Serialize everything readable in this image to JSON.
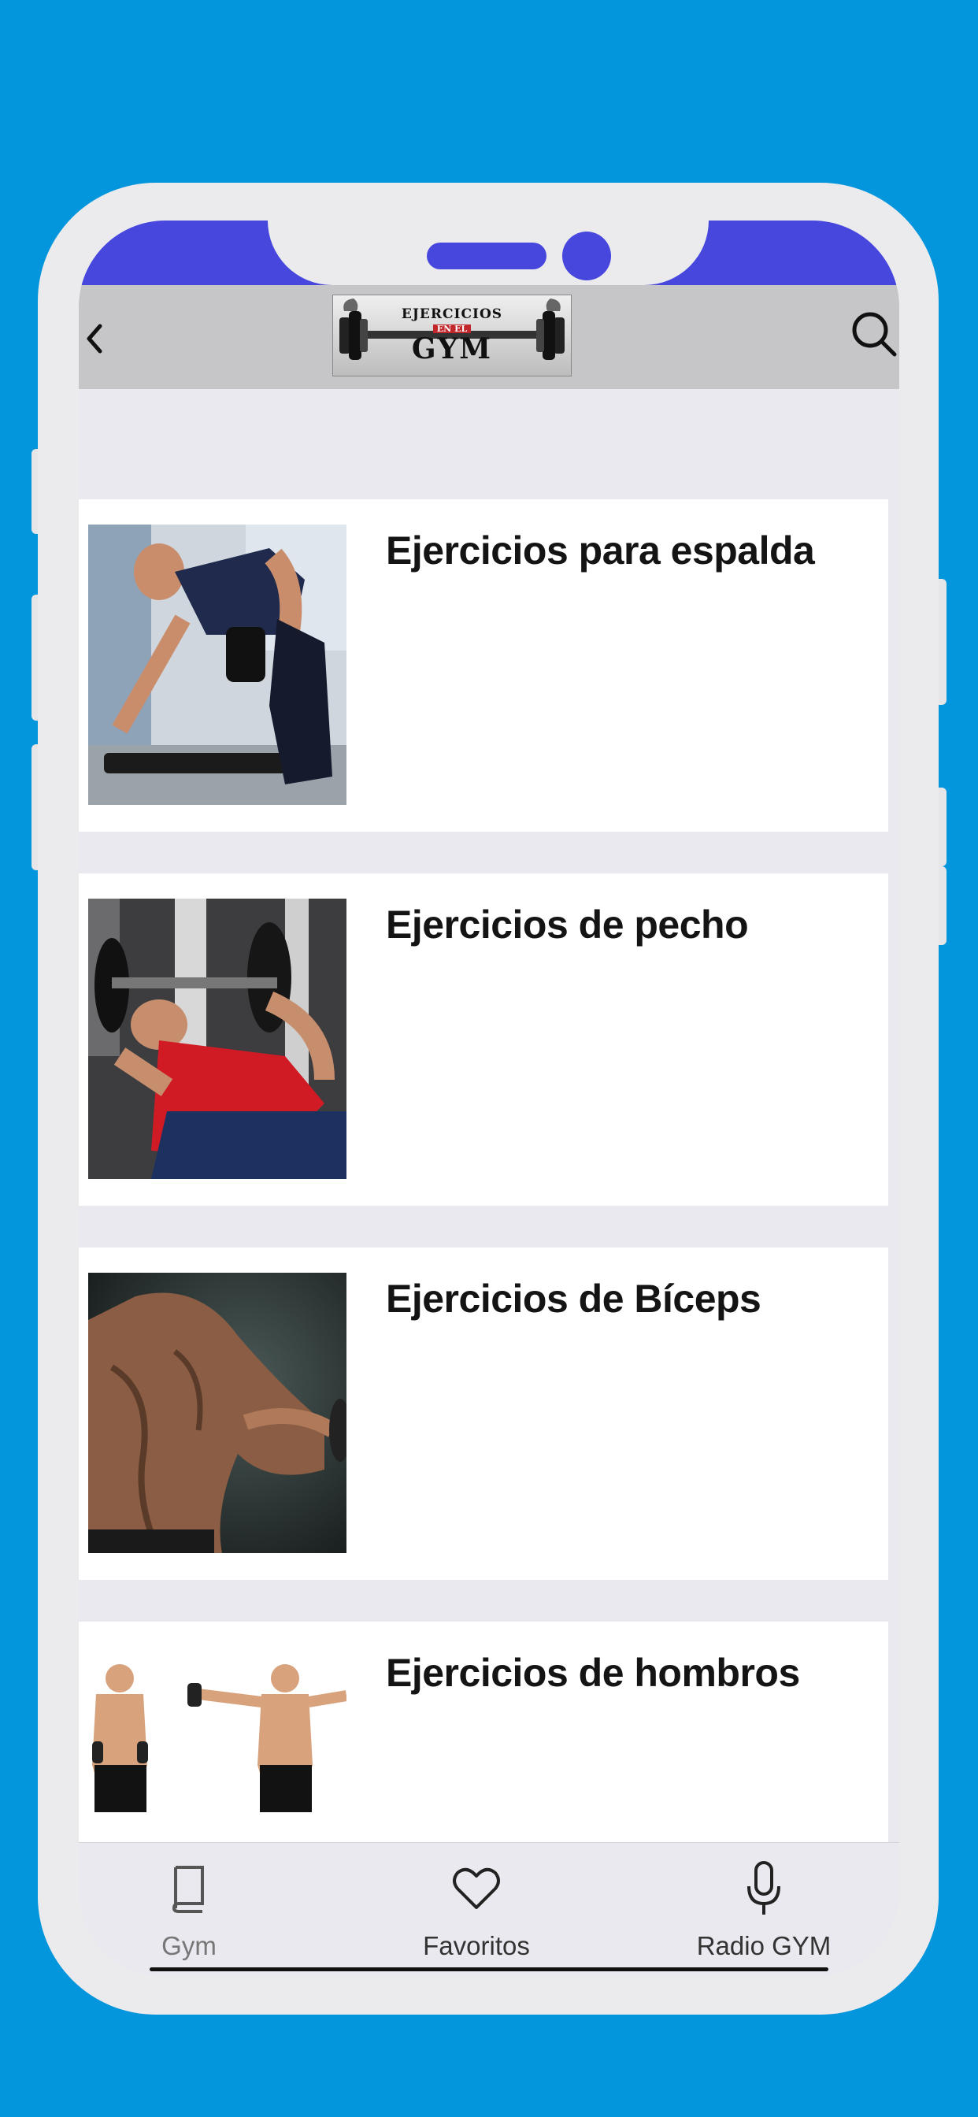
{
  "app": {
    "logo_text": [
      "EJERCICIOS",
      "EN EL",
      "GYM"
    ]
  },
  "toolbar": {
    "back_icon": "chevron-left-icon",
    "search_icon": "search-icon"
  },
  "categories": [
    {
      "title": "Ejercicios para espalda",
      "image": "back-exercise-photo"
    },
    {
      "title": "Ejercicios de pecho",
      "image": "chest-exercise-photo"
    },
    {
      "title": "Ejercicios de Bíceps",
      "image": "biceps-exercise-photo"
    },
    {
      "title": "Ejercicios de hombros",
      "image": "shoulders-exercise-photo"
    }
  ],
  "bottom_nav": {
    "items": [
      {
        "label": "Gym",
        "icon": "book-icon",
        "active": false
      },
      {
        "label": "Favoritos",
        "icon": "heart-icon",
        "active": true
      },
      {
        "label": "Radio GYM",
        "icon": "microphone-icon",
        "active": true
      }
    ]
  },
  "colors": {
    "background": "#0396dc",
    "accent": "#4747de",
    "toolbar": "#c6c6c9"
  }
}
